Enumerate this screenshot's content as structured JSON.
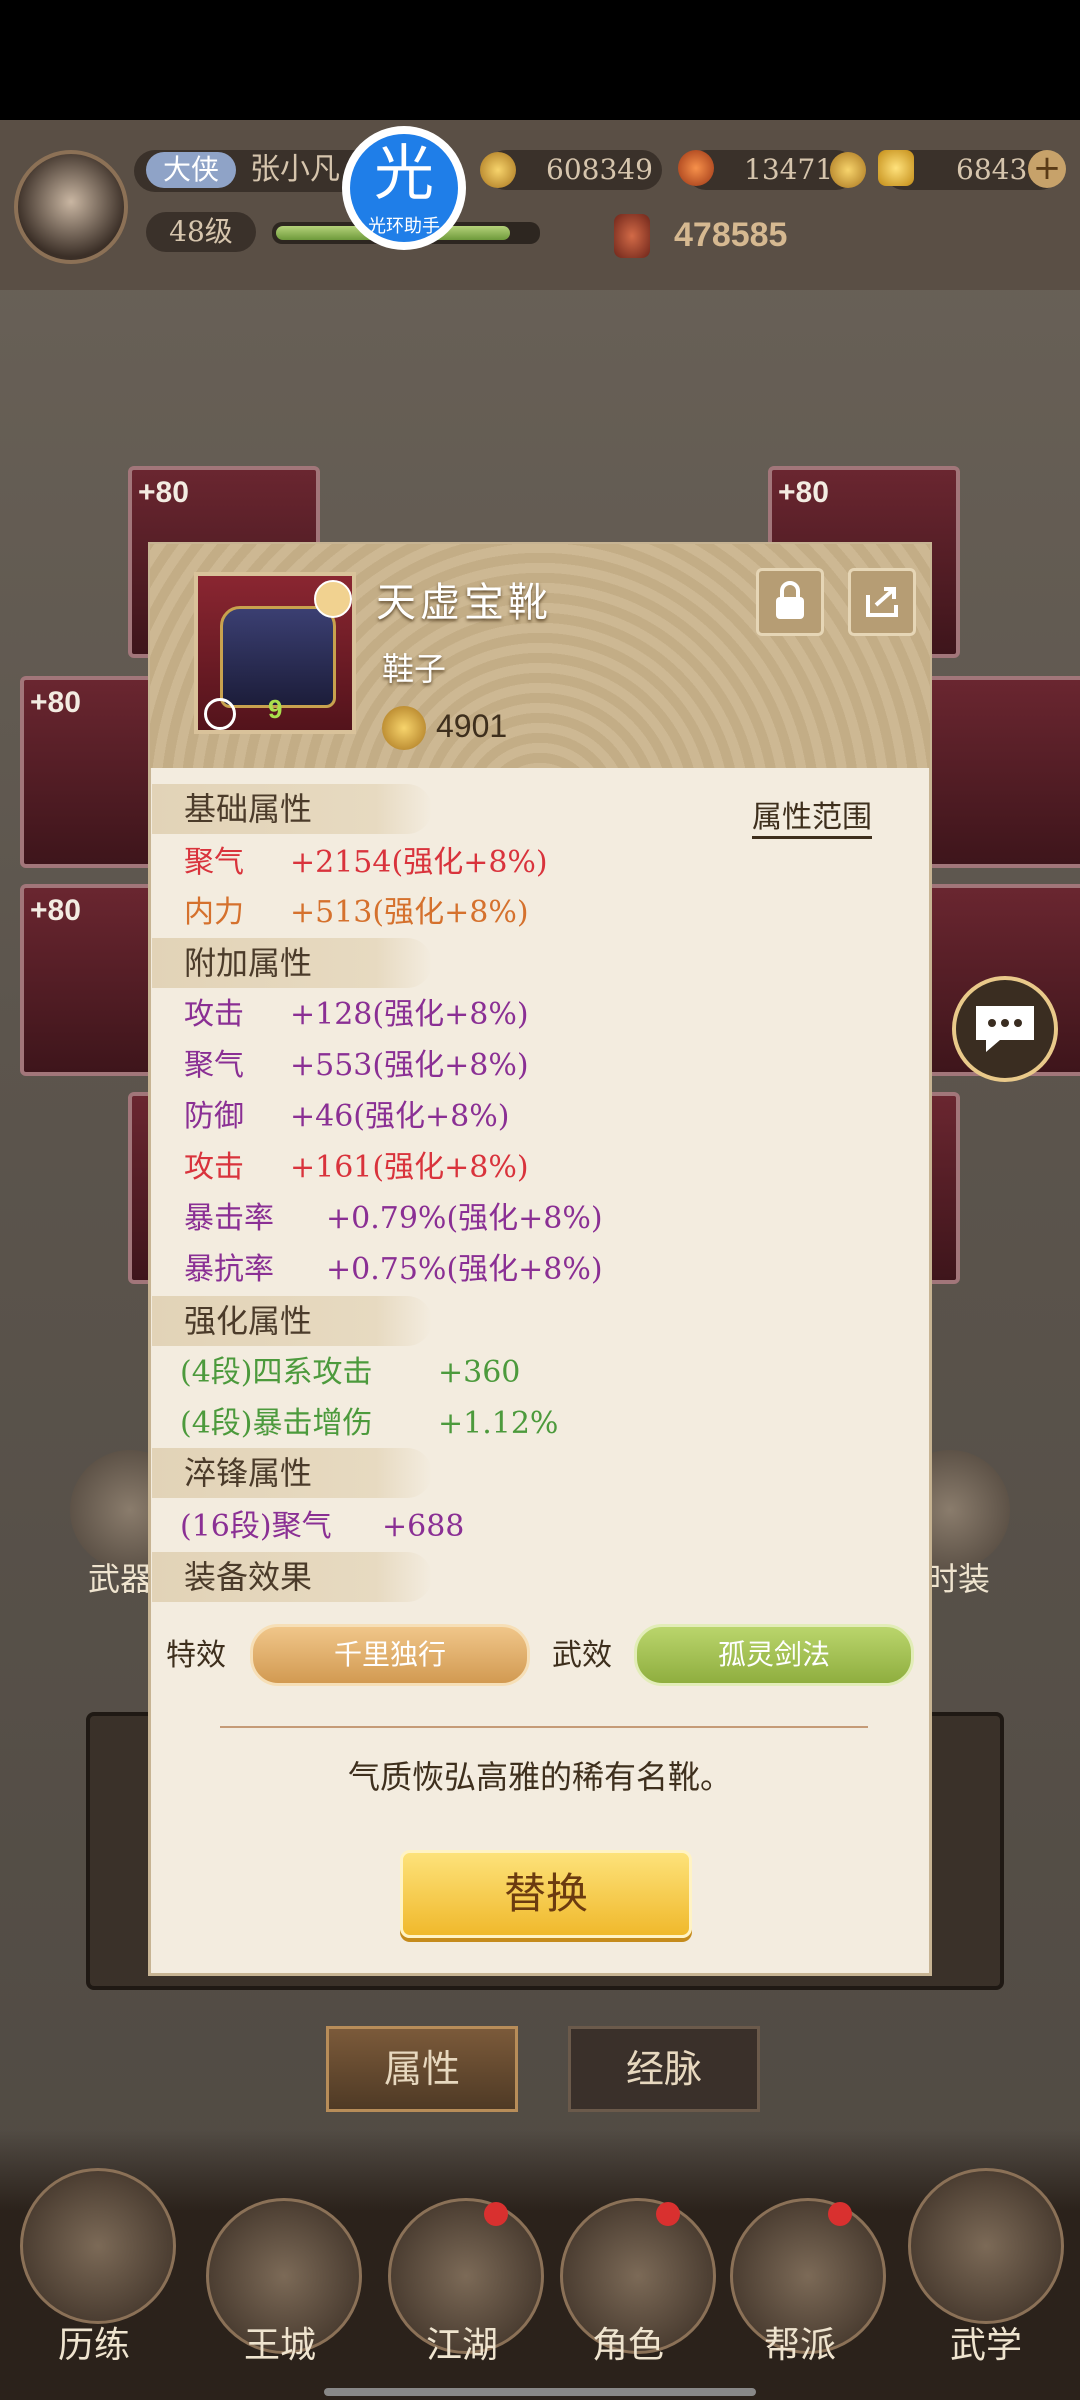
{
  "header": {
    "title_badge": "大侠",
    "player_name": "张小凡",
    "level": "48级",
    "copper": "608349",
    "gems": "13471",
    "gold": "6843",
    "power": "478585",
    "watermark": "光环助手",
    "watermark_glyph": "光"
  },
  "slots": [
    "+80",
    "+80",
    "+80",
    "+80",
    "+80"
  ],
  "item": {
    "name": "天虚宝靴",
    "type": "鞋子",
    "score": "4901",
    "level_badge": "9"
  },
  "sections": {
    "base": "基础属性",
    "extra": "附加属性",
    "enhance": "强化属性",
    "temper": "淬锋属性",
    "effect": "装备效果"
  },
  "range_link": "属性范围",
  "base_stats": [
    {
      "name": "聚气",
      "value": "+2154(强化+8%)"
    },
    {
      "name": "内力",
      "value": "+513(强化+8%)"
    }
  ],
  "extra_stats": [
    {
      "name": "攻击",
      "value": "+128(强化+8%)"
    },
    {
      "name": "聚气",
      "value": "+553(强化+8%)"
    },
    {
      "name": "防御",
      "value": "+46(强化+8%)"
    },
    {
      "name": "攻击",
      "value": "+161(强化+8%)"
    },
    {
      "name": "暴击率",
      "value": "+0.79%(强化+8%)"
    },
    {
      "name": "暴抗率",
      "value": "+0.75%(强化+8%)"
    }
  ],
  "enhance_stats": [
    {
      "name": "(4段)四系攻击",
      "value": "+360"
    },
    {
      "name": "(4段)暴击增伤",
      "value": "+1.12%"
    }
  ],
  "temper_stats": [
    {
      "name": "(16段)聚气",
      "value": "+688"
    }
  ],
  "effects": {
    "special_label": "特效",
    "special_value": "千里独行",
    "martial_label": "武效",
    "martial_value": "孤灵剑法"
  },
  "description": "气质恢弘高雅的稀有名靴。",
  "replace_button": "替换",
  "tabs": {
    "attributes": "属性",
    "meridians": "经脉"
  },
  "side_labels": {
    "left": "武器",
    "right": "时装"
  },
  "nav": [
    "历练",
    "王城",
    "江湖",
    "角色",
    "帮派",
    "武学"
  ],
  "colors": {
    "rare": "#d9333c",
    "gold_button": "#f2c94c",
    "special_tag": "#e3b273",
    "martial_tag": "#a6c45e"
  }
}
